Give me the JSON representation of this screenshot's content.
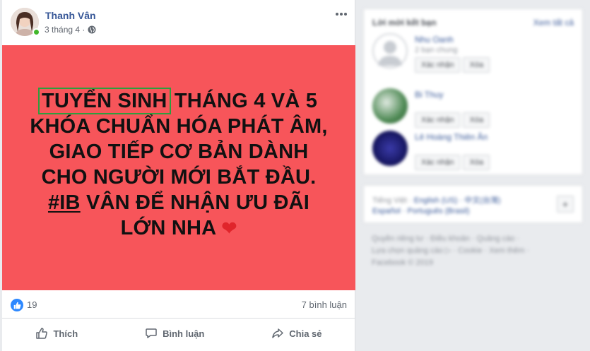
{
  "post": {
    "author": "Thanh Vân",
    "time": "3 tháng 4 ·",
    "banner": {
      "highlight": "TUYỂN SINH",
      "line1_rest": " THÁNG 4 VÀ 5",
      "line2": "KHÓA CHUẨN HÓA PHÁT ÂM,",
      "line3": "GIAO TIẾP CƠ BẢN DÀNH",
      "line4": "CHO NGƯỜI MỚI BẮT ĐẦU.",
      "hashtag": "#IB",
      "line5_rest": " VÂN ĐỂ NHẬN ƯU ĐÃI",
      "line6": "LỚN NHA",
      "heart": "❤",
      "bg_color": "#f7555a"
    },
    "likes": "19",
    "comments": "7 bình luận",
    "actions": {
      "like": "Thích",
      "comment": "Bình luận",
      "share": "Chia sẻ"
    }
  },
  "sidebar": {
    "suggest_title": "Lời mời kết bạn",
    "see_all": "Xem tất cả",
    "people": [
      {
        "name": "Nhu Oanh",
        "sub": "2 bạn chung",
        "confirm": "Xác nhận",
        "delete": "Xóa"
      },
      {
        "name": "Bi Thuy",
        "sub": "",
        "confirm": "Xác nhận",
        "delete": "Xóa"
      },
      {
        "name": "Lê Hoàng Thiên Ân",
        "sub": "",
        "confirm": "Xác nhận",
        "delete": "Xóa"
      }
    ],
    "languages": {
      "label": "Tiếng Việt ·",
      "line1_links": "English (US) · 中文(台灣)",
      "line2_links": "Español · Português (Brasil)",
      "add": "+"
    },
    "footer": {
      "line1": "Quyền riêng tư · Điều khoản · Quảng cáo ·",
      "line2": "Lựa chọn quảng cáo ▷ · Cookie · Xem thêm ·",
      "line3": "Facebook © 2019"
    }
  }
}
